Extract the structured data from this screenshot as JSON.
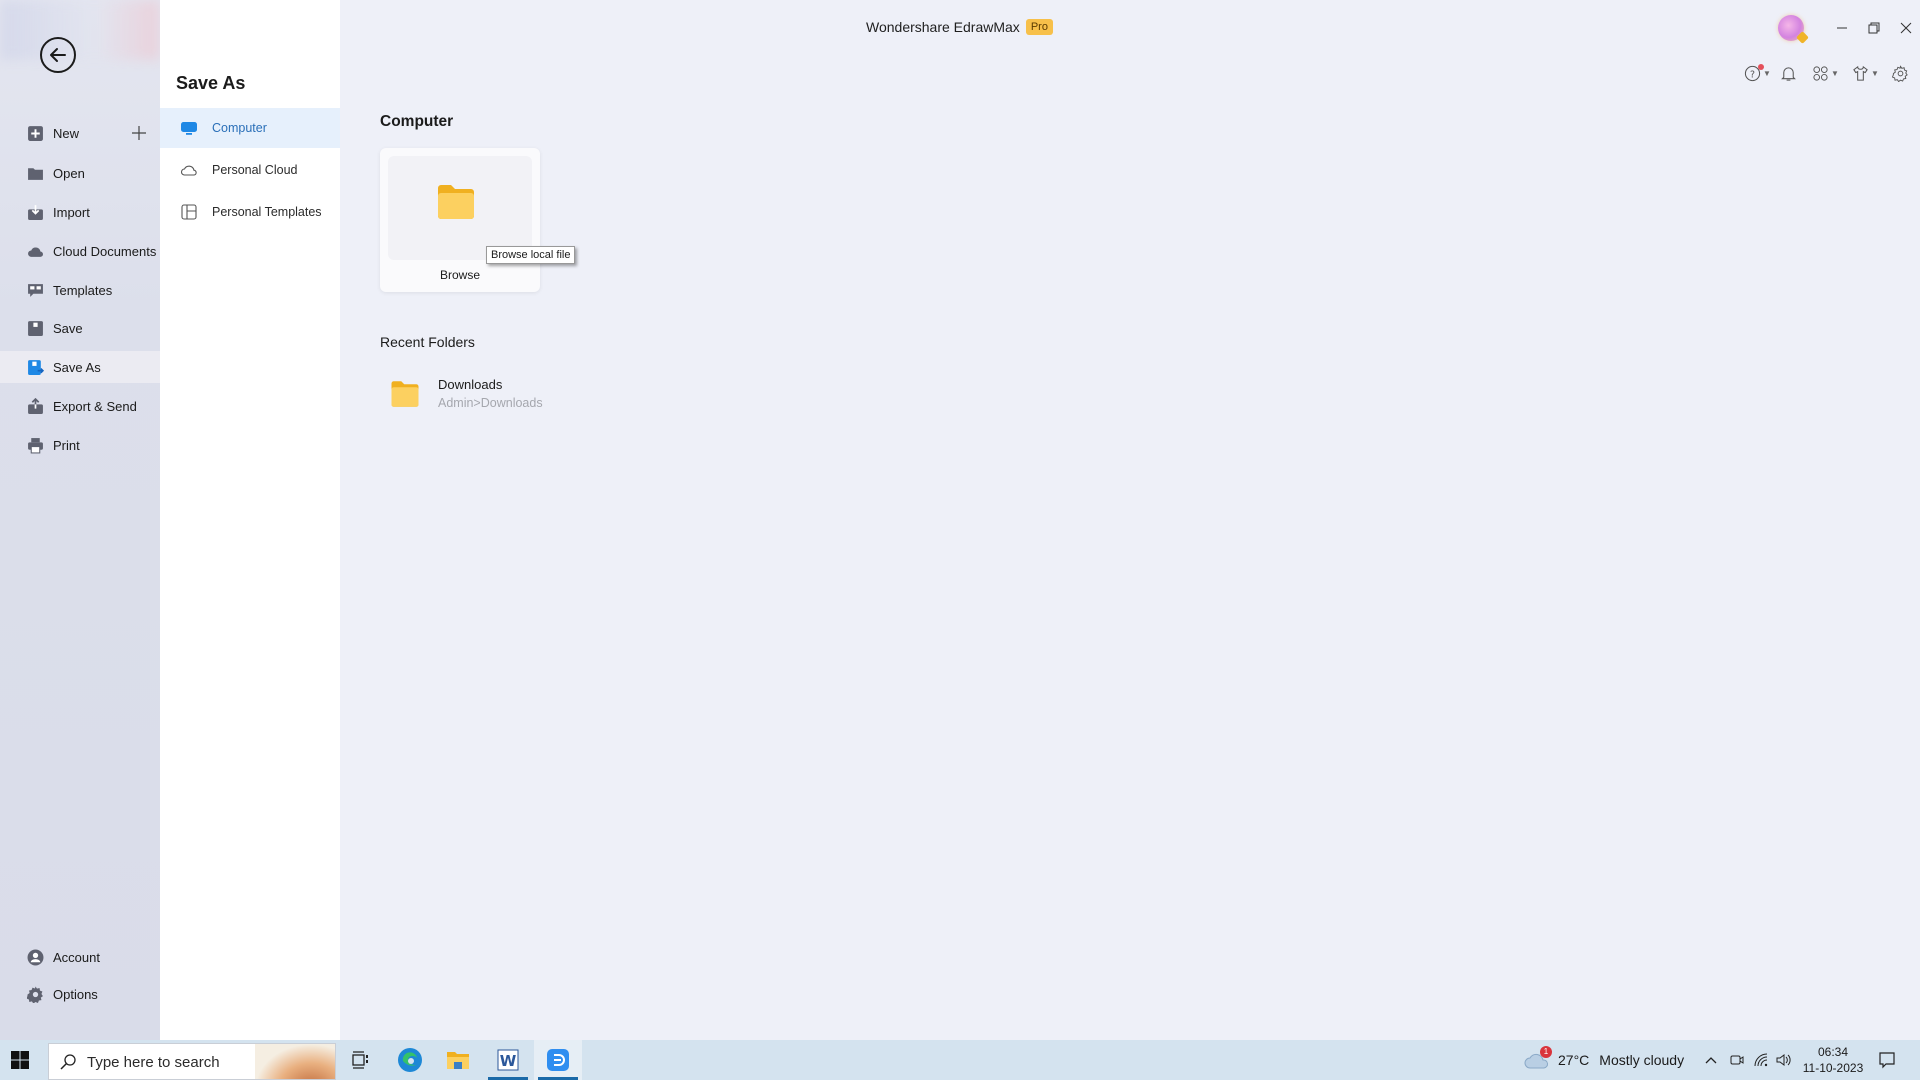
{
  "app": {
    "title": "Wondershare EdrawMax",
    "badge": "Pro"
  },
  "sidebar": {
    "back_icon": "back-arrow-icon",
    "items": [
      {
        "label": "New",
        "icon": "new-plus-square-icon"
      },
      {
        "label": "Open",
        "icon": "folder-icon"
      },
      {
        "label": "Import",
        "icon": "import-icon"
      },
      {
        "label": "Cloud Documents",
        "icon": "cloud-icon"
      },
      {
        "label": "Templates",
        "icon": "templates-icon"
      },
      {
        "label": "Save",
        "icon": "save-icon"
      },
      {
        "label": "Save As",
        "icon": "save-as-icon",
        "active": true
      },
      {
        "label": "Export & Send",
        "icon": "export-icon"
      },
      {
        "label": "Print",
        "icon": "print-icon"
      }
    ],
    "bottom": [
      {
        "label": "Account",
        "icon": "account-icon"
      },
      {
        "label": "Options",
        "icon": "gear-icon"
      }
    ]
  },
  "panel": {
    "title": "Save As",
    "items": [
      {
        "label": "Computer",
        "icon": "monitor-icon",
        "active": true
      },
      {
        "label": "Personal Cloud",
        "icon": "cloud-outline-icon"
      },
      {
        "label": "Personal Templates",
        "icon": "template-layout-icon"
      }
    ]
  },
  "main": {
    "section_title": "Computer",
    "browse": {
      "label": "Browse",
      "tooltip": "Browse local file"
    },
    "recent_title": "Recent Folders",
    "recent": [
      {
        "name": "Downloads",
        "path": "Admin>Downloads"
      }
    ]
  },
  "toolbar": {
    "icons": [
      "help-icon",
      "bell-icon",
      "apps-icon",
      "theme-shirt-icon",
      "settings-icon"
    ]
  },
  "taskbar": {
    "search_placeholder": "Type here to search",
    "weather": {
      "temp": "27°C",
      "condition": "Mostly cloudy",
      "badge": "1"
    },
    "time": "06:34",
    "date": "11-10-2023"
  },
  "colors": {
    "accent": "#1e88e5",
    "pro_badge": "#f7c04a",
    "folder": "#f7c64a",
    "selected_row": "#e6f0fc"
  }
}
